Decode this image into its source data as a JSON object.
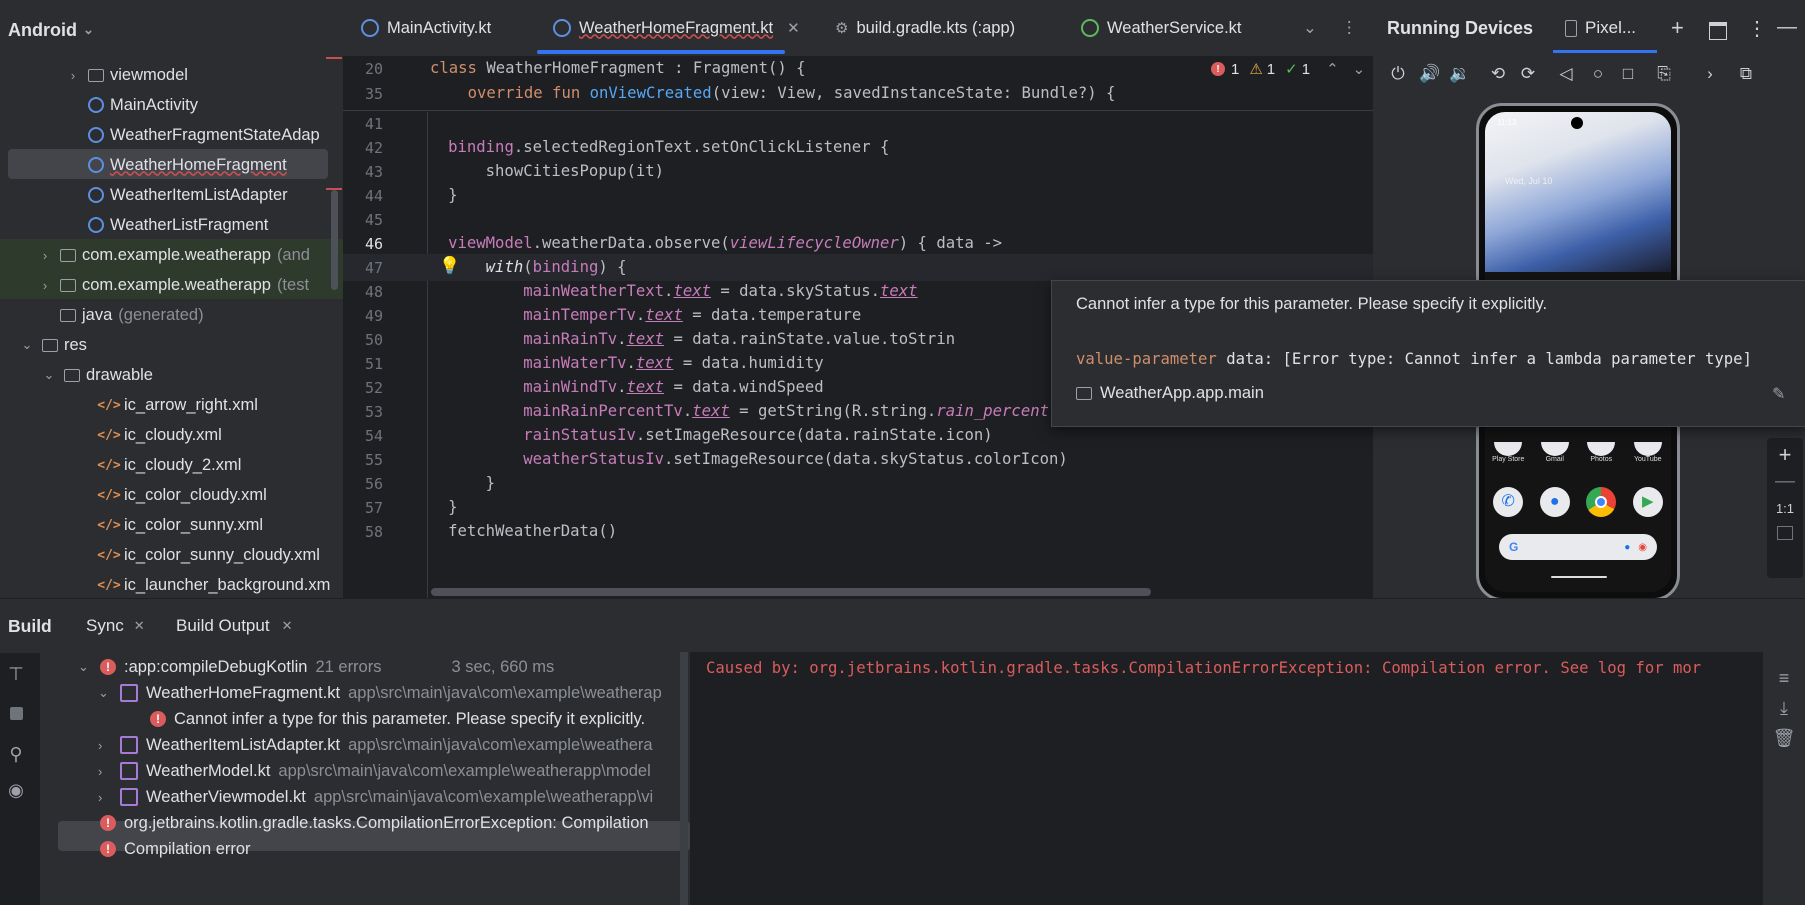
{
  "project": {
    "view_selector": "Android",
    "rows": [
      {
        "label": "viewmodel",
        "extra": "",
        "icon": "folder-icon",
        "chev": "›"
      },
      {
        "label": "MainActivity",
        "extra": "",
        "icon": "kotlin-class-icon",
        "chev": ""
      },
      {
        "label": "WeatherFragmentStateAdap",
        "extra": "",
        "icon": "kotlin-class-icon",
        "chev": ""
      },
      {
        "label": "WeatherHomeFragment",
        "extra": "",
        "icon": "kotlin-class-icon",
        "chev": ""
      },
      {
        "label": "WeatherItemListAdapter",
        "extra": "",
        "icon": "kotlin-class-icon",
        "chev": ""
      },
      {
        "label": "WeatherListFragment",
        "extra": "",
        "icon": "kotlin-class-icon",
        "chev": ""
      },
      {
        "label": "com.example.weatherapp",
        "extra": "(and",
        "icon": "package-icon",
        "chev": "›"
      },
      {
        "label": "com.example.weatherapp",
        "extra": "(test",
        "icon": "package-icon",
        "chev": "›"
      },
      {
        "label": "java",
        "extra": "(generated)",
        "icon": "folder-icon",
        "chev": ""
      },
      {
        "label": "res",
        "extra": "",
        "icon": "folder-icon",
        "chev": "⌄"
      },
      {
        "label": "drawable",
        "extra": "",
        "icon": "folder-icon",
        "chev": "⌄"
      },
      {
        "label": "ic_arrow_right.xml",
        "extra": "",
        "icon": "xml-file-icon",
        "chev": ""
      },
      {
        "label": "ic_cloudy.xml",
        "extra": "",
        "icon": "xml-file-icon",
        "chev": ""
      },
      {
        "label": "ic_cloudy_2.xml",
        "extra": "",
        "icon": "xml-file-icon",
        "chev": ""
      },
      {
        "label": "ic_color_cloudy.xml",
        "extra": "",
        "icon": "xml-file-icon",
        "chev": ""
      },
      {
        "label": "ic_color_sunny.xml",
        "extra": "",
        "icon": "xml-file-icon",
        "chev": ""
      },
      {
        "label": "ic_color_sunny_cloudy.xml",
        "extra": "",
        "icon": "xml-file-icon",
        "chev": ""
      },
      {
        "label": "ic_launcher_background.xm",
        "extra": "",
        "icon": "xml-file-icon",
        "chev": ""
      }
    ]
  },
  "tabs": [
    {
      "label": "MainActivity.kt"
    },
    {
      "label": "WeatherHomeFragment.kt"
    },
    {
      "label": "build.gradle.kts (:app)"
    },
    {
      "label": "WeatherService.kt"
    }
  ],
  "editor": {
    "sticky": [
      {
        "num": "20",
        "code": "class WeatherHomeFragment : Fragment() {"
      },
      {
        "num": "35",
        "code": "    override fun onViewCreated(view: View, savedInstanceState: Bundle?) {"
      }
    ],
    "inspection": {
      "errors": "1",
      "warnings": "1",
      "weak": "1"
    },
    "lines": [
      {
        "num": "41",
        "code": ""
      },
      {
        "num": "42",
        "code": "        binding.selectedRegionText.setOnClickListener {"
      },
      {
        "num": "43",
        "code": "            showCitiesPopup(it)"
      },
      {
        "num": "44",
        "code": "        }"
      },
      {
        "num": "45",
        "code": ""
      },
      {
        "num": "46",
        "code": "        viewModel.weatherData.observe(viewLifecycleOwner) { data ->"
      },
      {
        "num": "47",
        "code": "            with(binding) {"
      },
      {
        "num": "48",
        "code": "                mainWeatherText.text = data.skyStatus.text"
      },
      {
        "num": "49",
        "code": "                mainTemperTv.text = data.temperature"
      },
      {
        "num": "50",
        "code": "                mainRainTv.text = data.rainState.value.toStrin"
      },
      {
        "num": "51",
        "code": "                mainWaterTv.text = data.humidity"
      },
      {
        "num": "52",
        "code": "                mainWindTv.text = data.windSpeed"
      },
      {
        "num": "53",
        "code": "                mainRainPercentTv.text = getString(R.string.rain_percent, data.rainPercent)"
      },
      {
        "num": "54",
        "code": "                rainStatusIv.setImageResource(data.rainState.icon)"
      },
      {
        "num": "55",
        "code": "                weatherStatusIv.setImageResource(data.skyStatus.colorIcon)"
      },
      {
        "num": "56",
        "code": "            }"
      },
      {
        "num": "57",
        "code": "        }"
      },
      {
        "num": "58",
        "code": "        fetchWeatherData()"
      }
    ]
  },
  "tooltip": {
    "message": "Cannot infer a type for this parameter. Please specify it explicitly.",
    "signature_kw": "value-parameter",
    "signature_rest": " data: [Error type: Cannot infer a lambda parameter type]",
    "module": "WeatherApp.app.main"
  },
  "devices": {
    "title": "Running Devices",
    "device_tab": "Pixel...",
    "zoom": "1:1",
    "phone": {
      "time": "11:13",
      "widget": "Wed, Jul 10",
      "apps_row1": [
        "Play Store",
        "Gmail",
        "Photos",
        "YouTube"
      ]
    }
  },
  "build": {
    "tabs": [
      "Build",
      "Sync",
      "Build Output"
    ],
    "rows": [
      {
        "label": ":app:compileDebugKotlin",
        "extra": "21 errors",
        "time": "3 sec, 660 ms"
      },
      {
        "label": "WeatherHomeFragment.kt",
        "extra": "app\\src\\main\\java\\com\\example\\weatherap"
      },
      {
        "label": "Cannot infer a type for this parameter. Please specify it explicitly.",
        "extra": ""
      },
      {
        "label": "WeatherItemListAdapter.kt",
        "extra": "app\\src\\main\\java\\com\\example\\weathera"
      },
      {
        "label": "WeatherModel.kt",
        "extra": "app\\src\\main\\java\\com\\example\\weatherapp\\model"
      },
      {
        "label": "WeatherViewmodel.kt",
        "extra": "app\\src\\main\\java\\com\\example\\weatherapp\\vi"
      },
      {
        "label": "org.jetbrains.kotlin.gradle.tasks.CompilationErrorException: Compilation",
        "extra": ""
      },
      {
        "label": "Compilation error",
        "extra": ""
      }
    ],
    "log": "Caused by: org.jetbrains.kotlin.gradle.tasks.CompilationErrorException: Compilation error. See log for mor"
  }
}
